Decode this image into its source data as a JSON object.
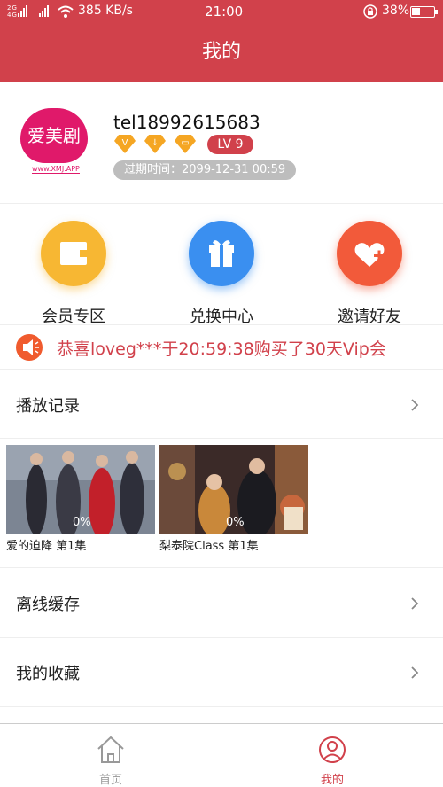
{
  "status_bar": {
    "signal_text": "2G\n4G",
    "speed": "385 KB/s",
    "time": "21:00",
    "battery_percent": "38%",
    "battery_level": 0.38
  },
  "header": {
    "title": "我的"
  },
  "profile": {
    "avatar_logo_text": "爱美剧",
    "avatar_url_text": "www.XMJ.APP",
    "username": "tel18992615683",
    "badges": [
      "V",
      "↓",
      "▭"
    ],
    "level": "LV 9",
    "expire": "过期时间：2099-12-31 00:59"
  },
  "actions": [
    {
      "label": "会员专区",
      "icon": "wallet-icon",
      "color": "#f7b733"
    },
    {
      "label": "兑换中心",
      "icon": "gift-icon",
      "color": "#3a8ff0"
    },
    {
      "label": "邀请好友",
      "icon": "heart-plus-icon",
      "color": "#f25a3a"
    }
  ],
  "notice": {
    "text": "恭喜loveg***于20:59:38购买了30天Vip会"
  },
  "rows": {
    "history": "播放记录",
    "offline": "离线缓存",
    "favorites": "我的收藏"
  },
  "history_items": [
    {
      "title": "爱的迫降 第1集",
      "progress": "0%"
    },
    {
      "title": "梨泰院Class 第1集",
      "progress": "0%"
    }
  ],
  "tabbar": [
    {
      "label": "首页",
      "icon": "home-icon",
      "active": false
    },
    {
      "label": "我的",
      "icon": "profile-icon",
      "active": true
    }
  ],
  "colors": {
    "accent": "#d1414b",
    "inactive": "#999999"
  }
}
